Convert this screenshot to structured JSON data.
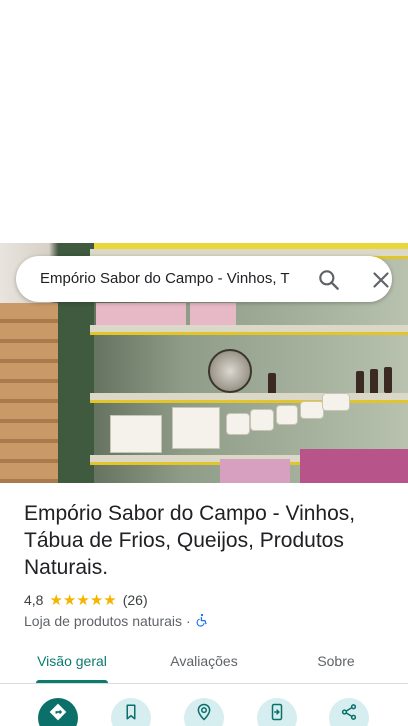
{
  "search": {
    "query": "Empório Sabor do Campo - Vinhos, T"
  },
  "place": {
    "title": "Empório Sabor do Campo - Vinhos, Tábua de Frios, Queijos, Produtos Naturais.",
    "rating": "4,8",
    "stars": 5,
    "review_count": "(26)",
    "category": "Loja de produtos naturais",
    "separator": "·"
  },
  "tabs": [
    {
      "label": "Visão geral",
      "active": true
    },
    {
      "label": "Avaliações",
      "active": false
    },
    {
      "label": "Sobre",
      "active": false
    }
  ],
  "actions": [
    {
      "icon": "directions-icon"
    },
    {
      "icon": "bookmark-icon"
    },
    {
      "icon": "nearby-icon"
    },
    {
      "icon": "send-to-phone-icon"
    },
    {
      "icon": "share-icon"
    }
  ],
  "colors": {
    "accent": "#0b7a6f",
    "star": "#f4b400",
    "action_bg": "#d6eef0",
    "primary_action_bg": "#0b6f6a"
  }
}
